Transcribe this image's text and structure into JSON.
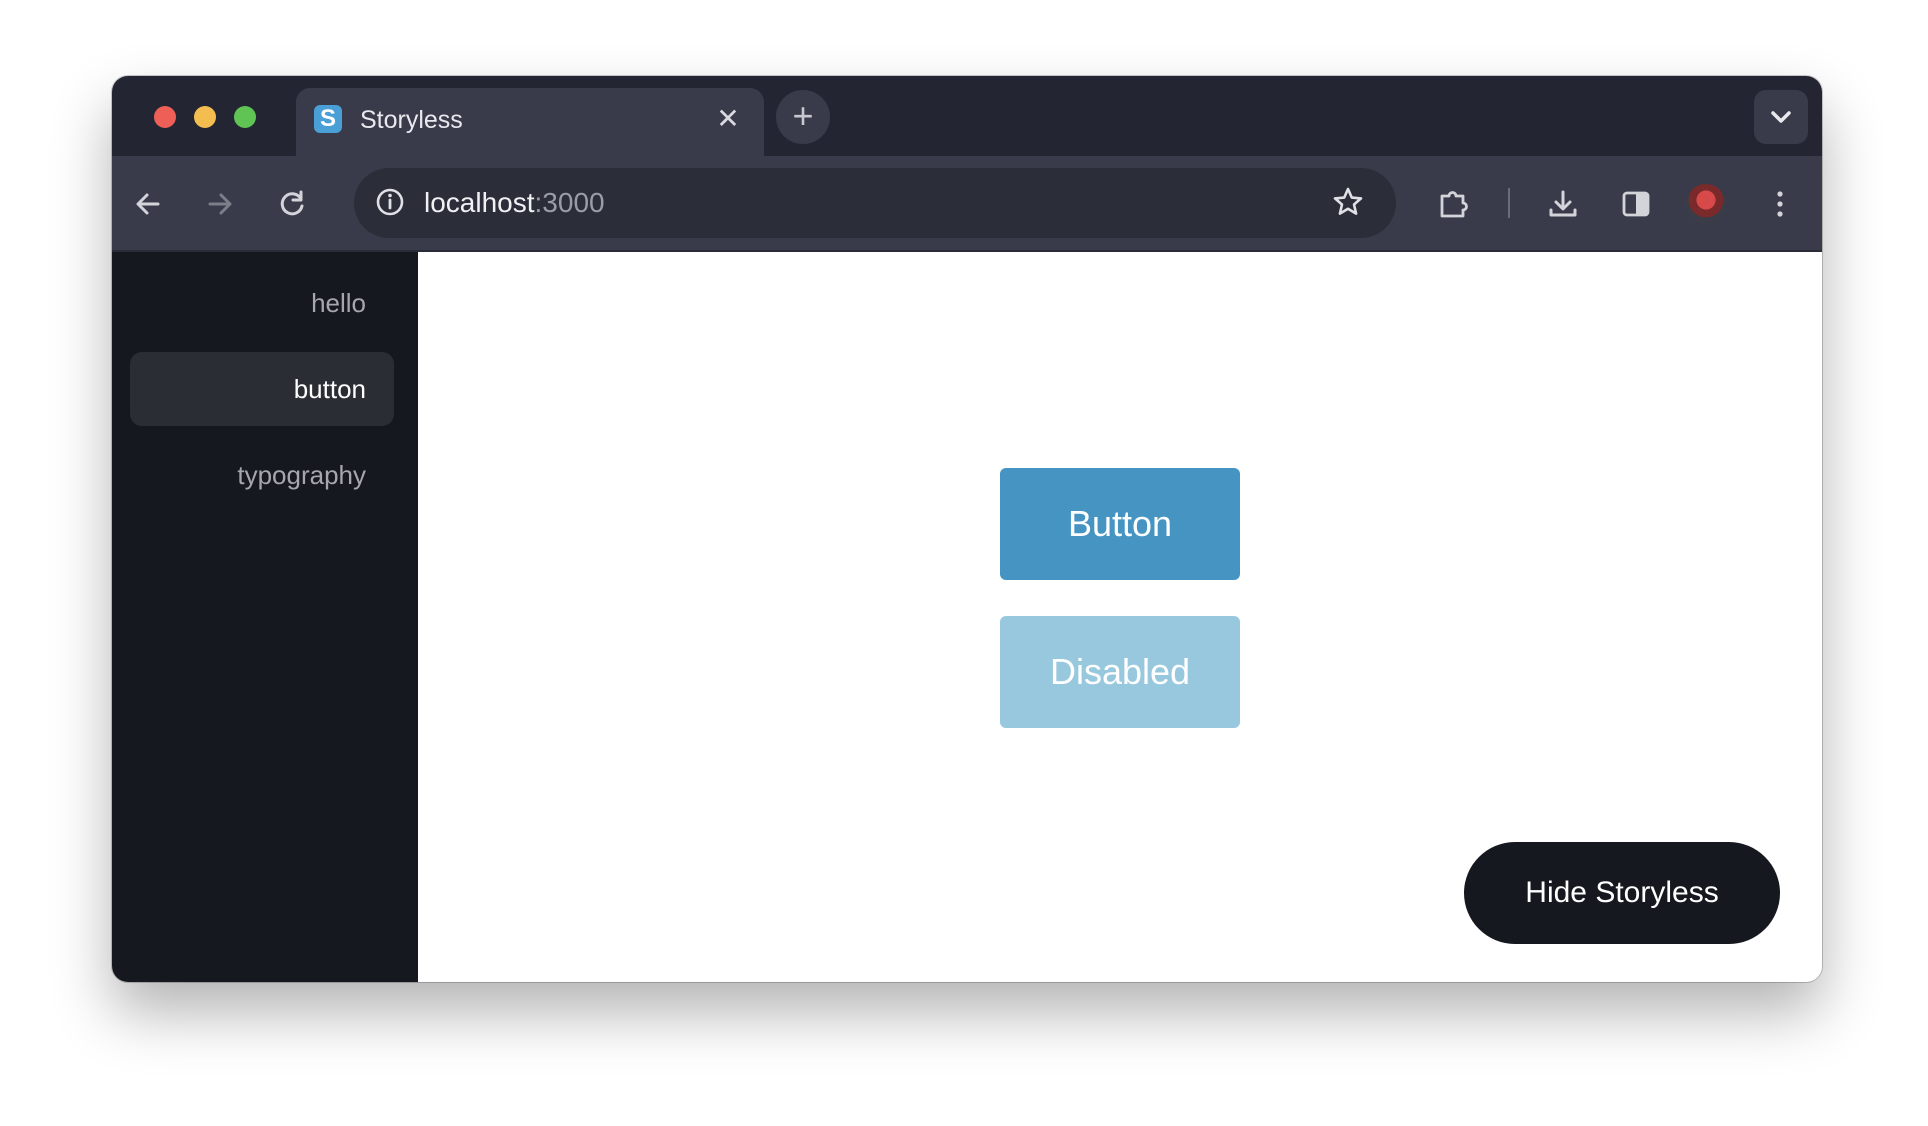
{
  "browser": {
    "tab": {
      "favicon_letter": "S",
      "title": "Storyless",
      "close_glyph": "✕"
    },
    "new_tab_glyph": "+",
    "address": {
      "host": "localhost",
      "port": ":3000"
    },
    "icons": [
      "back-arrow-icon",
      "forward-arrow-icon",
      "reload-icon",
      "info-icon",
      "star-icon",
      "extensions-icon",
      "download-icon",
      "side-panel-icon",
      "avatar",
      "more-vert-icon",
      "chevron-down-icon"
    ]
  },
  "sidebar": {
    "items": [
      {
        "label": "hello",
        "active": false
      },
      {
        "label": "button",
        "active": true
      },
      {
        "label": "typography",
        "active": false
      }
    ]
  },
  "main": {
    "primary_button": "Button",
    "disabled_button": "Disabled",
    "hide_button": "Hide Storyless"
  },
  "colors": {
    "primary": "#4594c2",
    "disabled": "#98c8de",
    "sidebar_bg": "#15181e",
    "active_item_bg": "#2a2d33"
  }
}
